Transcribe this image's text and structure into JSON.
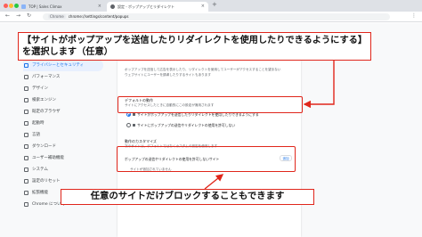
{
  "browser": {
    "tabs": [
      {
        "title": "TOP | Sales Climax",
        "active": false
      },
      {
        "title": "設定 - ポップアップとリダイレクト",
        "active": true
      }
    ],
    "new_tab": "+",
    "address": {
      "badge": "Chrome",
      "url": "chrome://settings/content/popups"
    },
    "menu": "⋮",
    "nav": {
      "back": "←",
      "forward": "→",
      "reload": "↻"
    }
  },
  "sidebar": {
    "items": [
      {
        "label": "自動入力とパスワード",
        "active": false
      },
      {
        "label": "プライバシーとセキュリティ",
        "active": true
      },
      {
        "label": "パフォーマンス",
        "active": false
      },
      {
        "label": "デザイン",
        "active": false
      },
      {
        "label": "検索エンジン",
        "active": false
      },
      {
        "label": "既定のブラウザ",
        "active": false
      },
      {
        "label": "起動時",
        "active": false
      },
      {
        "label": "言語",
        "active": false
      },
      {
        "label": "ダウンロード",
        "active": false
      },
      {
        "label": "ユーザー補助機能",
        "active": false
      },
      {
        "label": "システム",
        "active": false
      },
      {
        "label": "設定のリセット",
        "active": false
      },
      {
        "label": "拡張機能",
        "active": false
      },
      {
        "label": "Chrome について",
        "active": false
      }
    ]
  },
  "content": {
    "description_1": "ポップアップを送信して広告を表示したり、リダイレクトを使用してユーザーがアクセスすることを望まない",
    "description_2": "ウェブサイトにユーザーを誘導したりするサイトもあります",
    "default_heading": "デフォルトの動作",
    "default_sub": "サイトにアクセスしたときに自動的にこの設定が適用されます",
    "option_allow": "サイトがポップアップを送信したりリダイレクトを使用したりできるようにする",
    "option_block": "サイトにポップアップの送信やリダイレクトの使用を許可しない",
    "custom_heading": "動作のカスタマイズ",
    "custom_sub": "次のサイトは、デフォルトではなくカスタムの設定を使用します",
    "not_allowed_heading": "ポップアップの送信やリダイレクトの使用を許可しないサイト",
    "not_allowed_empty": "サイトが追加されていません",
    "add_button": "追加"
  },
  "annotations": {
    "top_line_1": "【サイトがポップアップを送信したりリダイレクトを使用したりできるようにする】",
    "top_line_2": "を選択します（任意）",
    "bottom": "任意のサイトだけブロックすることもできます"
  },
  "colors": {
    "annotation_red": "#e0261b",
    "accent_blue": "#1a73e8"
  }
}
